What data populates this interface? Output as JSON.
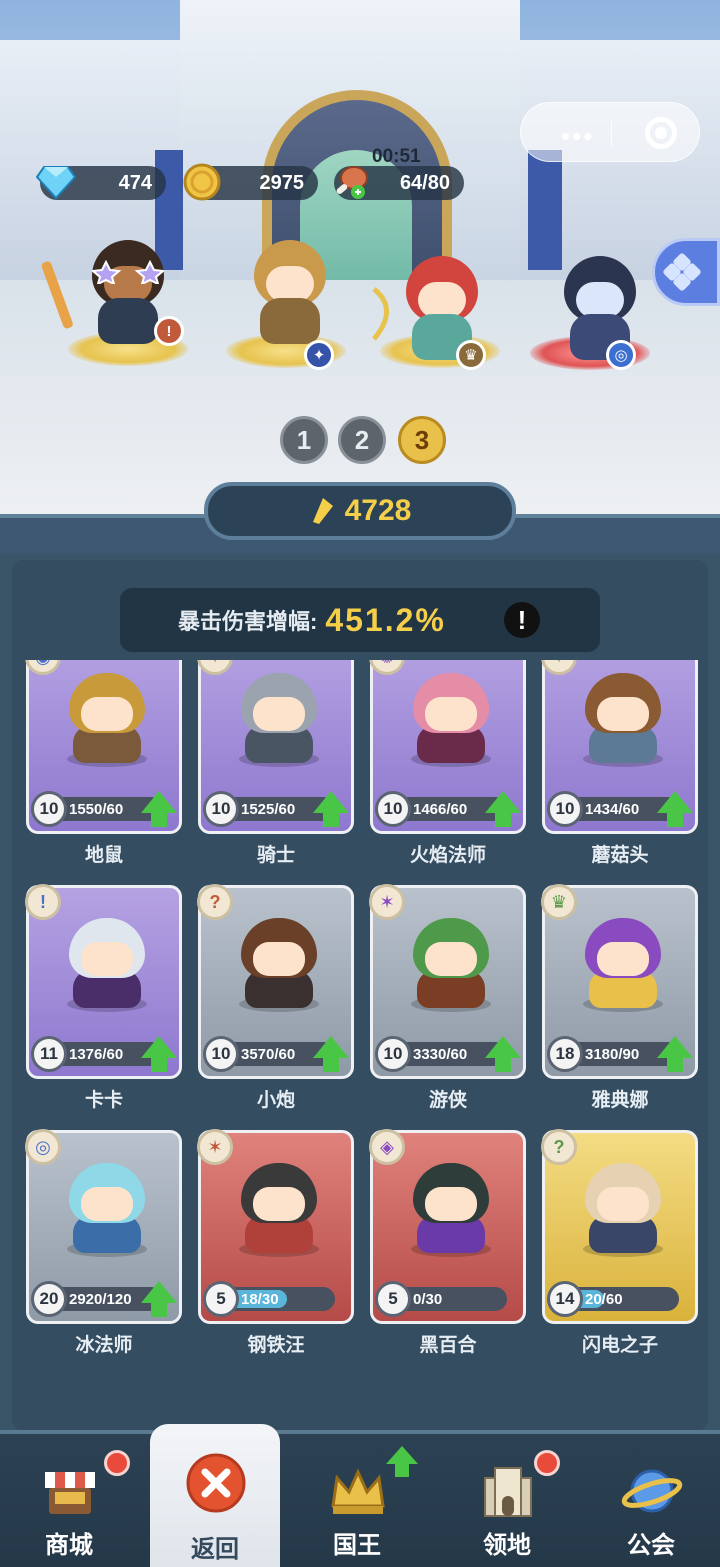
{
  "resources": {
    "diamonds": "474",
    "gold": "2975",
    "stamina_timer": "00:51",
    "stamina": "64/80"
  },
  "team_tabs": [
    "1",
    "2",
    "3"
  ],
  "active_team": "3",
  "power": "4728",
  "crit": {
    "label": "暴击伤害增幅:",
    "value": "451.2%",
    "info": "!"
  },
  "heroes": [
    {
      "name": "地鼠",
      "level": "10",
      "progress": "1550/60",
      "rarity": "purple",
      "upgrade": true,
      "fill": 1
    },
    {
      "name": "骑士",
      "level": "10",
      "progress": "1525/60",
      "rarity": "purple",
      "upgrade": true,
      "fill": 1
    },
    {
      "name": "火焰法师",
      "level": "10",
      "progress": "1466/60",
      "rarity": "purple",
      "upgrade": true,
      "fill": 1
    },
    {
      "name": "蘑菇头",
      "level": "10",
      "progress": "1434/60",
      "rarity": "purple",
      "upgrade": true,
      "fill": 1
    },
    {
      "name": "卡卡",
      "level": "11",
      "progress": "1376/60",
      "rarity": "purple",
      "upgrade": true,
      "fill": 1
    },
    {
      "name": "小炮",
      "level": "10",
      "progress": "3570/60",
      "rarity": "gray",
      "upgrade": true,
      "fill": 1
    },
    {
      "name": "游侠",
      "level": "10",
      "progress": "3330/60",
      "rarity": "gray",
      "upgrade": true,
      "fill": 1
    },
    {
      "name": "雅典娜",
      "level": "18",
      "progress": "3180/90",
      "rarity": "gray",
      "upgrade": true,
      "fill": 1
    },
    {
      "name": "冰法师",
      "level": "20",
      "progress": "2920/120",
      "rarity": "gray",
      "upgrade": true,
      "fill": 1
    },
    {
      "name": "钢铁汪",
      "level": "5",
      "progress": "18/30",
      "rarity": "red",
      "upgrade": false,
      "fill": 0.6
    },
    {
      "name": "黑百合",
      "level": "5",
      "progress": "0/30",
      "rarity": "red",
      "upgrade": false,
      "fill": 0
    },
    {
      "name": "闪电之子",
      "level": "14",
      "progress": "20/60",
      "rarity": "gold",
      "upgrade": false,
      "fill": 0.33
    }
  ],
  "nav": [
    {
      "label": "商城",
      "icon": "shop-icon",
      "dot": true
    },
    {
      "label": "返回",
      "icon": "close-icon",
      "active": true
    },
    {
      "label": "国王",
      "icon": "crown-icon",
      "arrow": true
    },
    {
      "label": "领地",
      "icon": "castle-icon",
      "dot": true
    },
    {
      "label": "公会",
      "icon": "planet-icon"
    }
  ],
  "colors": {
    "panel": "#3a5468",
    "gold_text": "#f6cf4a",
    "active_team": "#e8c04a",
    "upgrade_green": "#49c646",
    "notify_red": "#e84a3c"
  }
}
